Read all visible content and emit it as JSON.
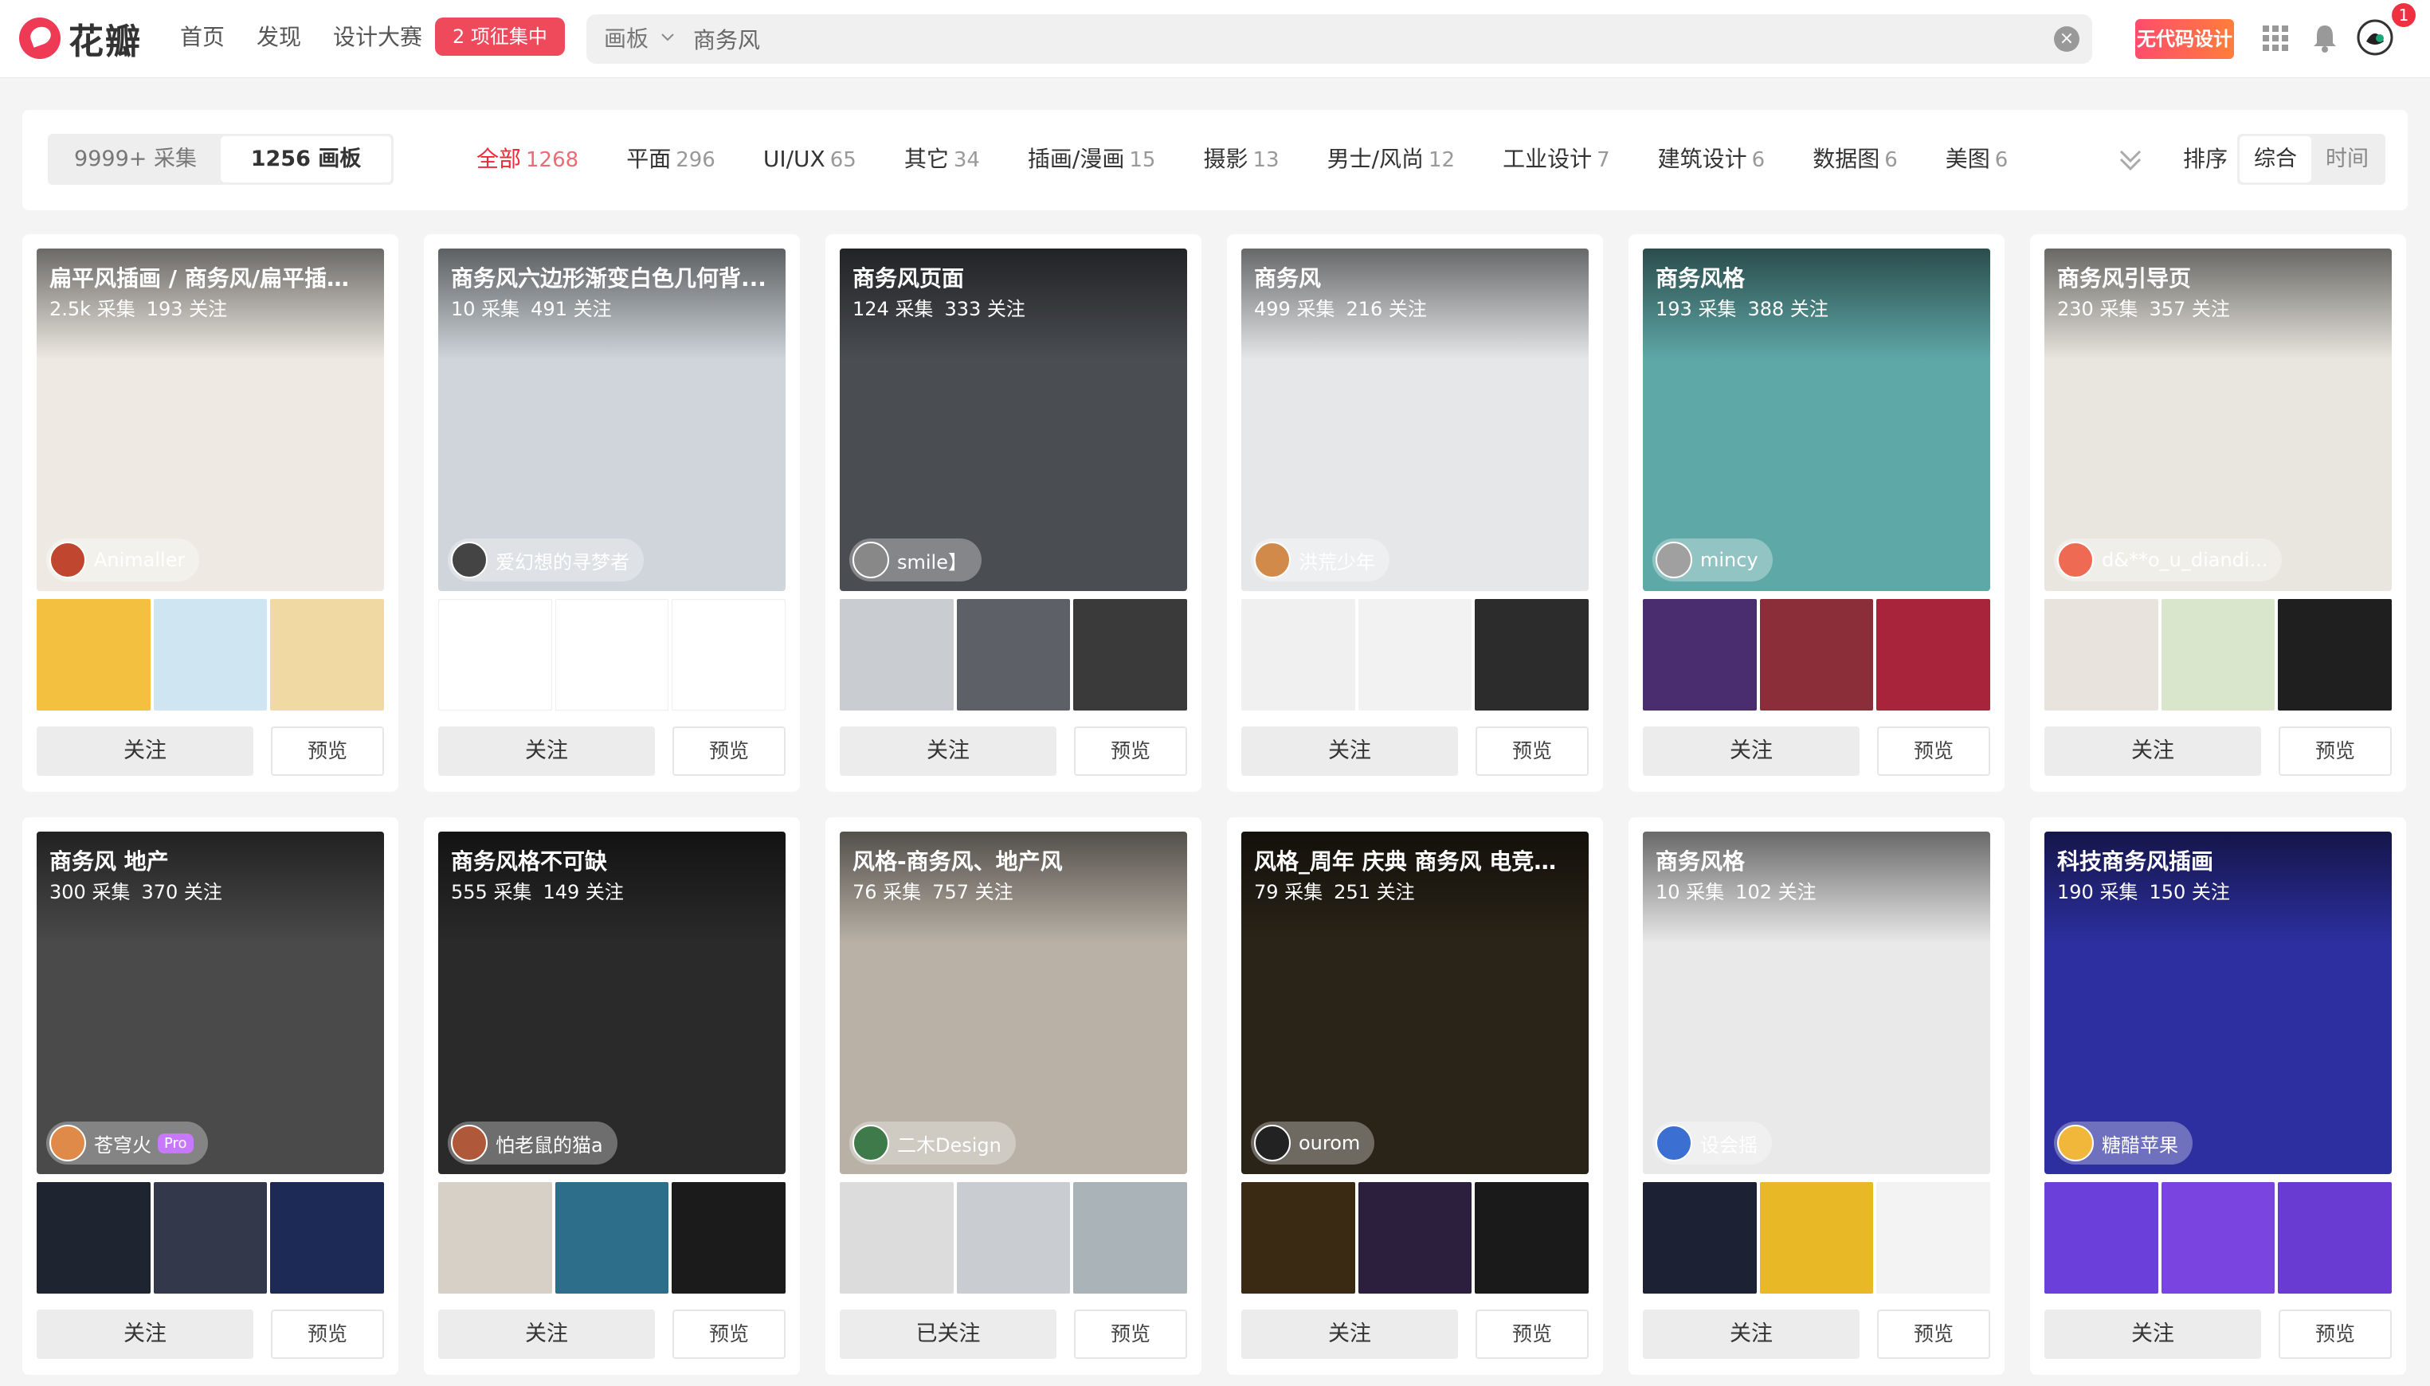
{
  "app": {
    "logo_text": "花瓣",
    "nav": [
      "首页",
      "发现",
      "设计大赛"
    ],
    "nav_badge": "2 项征集中",
    "search": {
      "scope": "画板",
      "value": "商务风"
    },
    "promo_label": "无代码设计",
    "notification_count": "1",
    "accent_color": "#ee2a3a"
  },
  "filter": {
    "segments": [
      {
        "label": "9999+ 采集",
        "active": false
      },
      {
        "label": "1256 画板",
        "active": true
      }
    ],
    "categories": [
      {
        "name": "全部",
        "count": "1268",
        "active": true
      },
      {
        "name": "平面",
        "count": "296"
      },
      {
        "name": "UI/UX",
        "count": "65"
      },
      {
        "name": "其它",
        "count": "34"
      },
      {
        "name": "插画/漫画",
        "count": "15"
      },
      {
        "name": "摄影",
        "count": "13"
      },
      {
        "name": "男士/风尚",
        "count": "12"
      },
      {
        "name": "工业设计",
        "count": "7"
      },
      {
        "name": "建筑设计",
        "count": "6"
      },
      {
        "name": "数据图",
        "count": "6"
      },
      {
        "name": "美图",
        "count": "6"
      }
    ],
    "sort_label": "排序",
    "sort_options": [
      {
        "label": "综合",
        "active": true
      },
      {
        "label": "时间",
        "active": false
      }
    ]
  },
  "boards": [
    {
      "title": "扁平风插画 / 商务风/扁平插画...",
      "stats": [
        "2.5k 采集",
        "193 关注"
      ],
      "owner": "Animaller",
      "follow": "关注",
      "preview": "预览",
      "cover": "#eeeae3",
      "avatar": "#c0462f",
      "thumbs": [
        "#f3c03f",
        "#cfe6f2",
        "#f1d9a4"
      ]
    },
    {
      "title": "商务风六边形渐变白色几何背...",
      "stats": [
        "10 采集",
        "491 关注"
      ],
      "owner": "爱幻想的寻梦者",
      "follow": "关注",
      "preview": "预览",
      "cover": "#cfd5da",
      "avatar": "#444",
      "thumbs": [
        "blank",
        "blank",
        "blank"
      ]
    },
    {
      "title": "商务风页面",
      "stats": [
        "124 采集",
        "333 关注"
      ],
      "owner": "smile】",
      "follow": "关注",
      "preview": "预览",
      "cover": "#4a4d52",
      "avatar": "#888",
      "thumbs": [
        "#c9cdd2",
        "#5d6066",
        "#3a3a3a"
      ]
    },
    {
      "title": "商务风",
      "stats": [
        "499 采集",
        "216 关注"
      ],
      "owner": "洪荒少年",
      "follow": "关注",
      "preview": "预览",
      "cover": "#e6e7e9",
      "avatar": "#d18a4a",
      "thumbs": [
        "#f0f0f0",
        "#f2f2f2",
        "#2c2c2c"
      ]
    },
    {
      "title": "商务风格",
      "stats": [
        "193 采集",
        "388 关注"
      ],
      "owner": "mincy",
      "follow": "关注",
      "preview": "预览",
      "cover": "#5fa8a8",
      "avatar": "#a0a0a0",
      "thumbs": [
        "#4a2d6e",
        "#8c2d3a",
        "#a8243a"
      ]
    },
    {
      "title": "商务风引导页",
      "stats": [
        "230 采集",
        "357 关注"
      ],
      "owner": "d&**o_u_diandi...",
      "follow": "关注",
      "preview": "预览",
      "cover": "#e9e6df",
      "avatar": "#ef6a52",
      "thumbs": [
        "#e8e4dd",
        "#d9e6cc",
        "#1f1f1f"
      ]
    },
    {
      "title": "商务风 地产",
      "stats": [
        "300 采集",
        "370 关注"
      ],
      "owner": "苍穹火",
      "pro": "Pro",
      "follow": "关注",
      "preview": "预览",
      "cover": "#4a4a4a",
      "avatar": "#e08a4a",
      "thumbs": [
        "#1e2531",
        "#33394a",
        "#1d2a55"
      ]
    },
    {
      "title": "商务风格不可缺",
      "stats": [
        "555 采集",
        "149 关注"
      ],
      "owner": "怕老鼠的猫a",
      "follow": "关注",
      "preview": "预览",
      "cover": "#2a2a2a",
      "avatar": "#b0583a",
      "thumbs": [
        "#d6d0c6",
        "#2d6e8a",
        "#1b1b1b"
      ]
    },
    {
      "title": "风格-商务风、地产风",
      "stats": [
        "76 采集",
        "757 关注"
      ],
      "owner": "二木Design",
      "follow": "已关注",
      "preview": "预览",
      "cover": "#b9b1a6",
      "avatar": "#3f7a4a",
      "thumbs": [
        "#dcdcdc",
        "#c9ccd0",
        "#a9b3b8"
      ]
    },
    {
      "title": "风格_周年 庆典 商务风 电竞赛...",
      "stats": [
        "79 采集",
        "251 关注"
      ],
      "owner": "ourom",
      "follow": "关注",
      "preview": "预览",
      "cover": "#2a2418",
      "avatar": "#222",
      "thumbs": [
        "#3a2a14",
        "#2c1f3e",
        "#1a1a1a"
      ]
    },
    {
      "title": "商务风格",
      "stats": [
        "10 采集",
        "102 关注"
      ],
      "owner": "设会摇",
      "follow": "关注",
      "preview": "预览",
      "cover": "#e9e9e9",
      "avatar": "#3b6fd1",
      "thumbs": [
        "#1c2233",
        "#e8b826",
        "#f3f3f3"
      ]
    },
    {
      "title": "科技商务风插画",
      "stats": [
        "190 采集",
        "150 关注"
      ],
      "owner": "糖醋苹果",
      "follow": "关注",
      "preview": "预览",
      "cover": "#2d2fa0",
      "avatar": "#f1b73a",
      "thumbs": [
        "#6b3fd9",
        "#7a44e0",
        "#6a3bd2"
      ]
    }
  ]
}
